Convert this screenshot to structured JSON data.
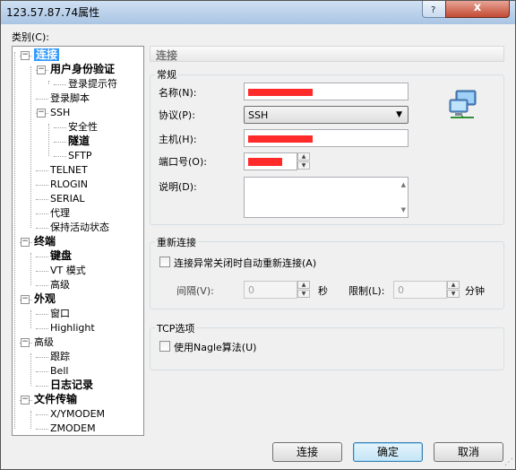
{
  "window": {
    "title": "123.57.87.74属性",
    "close_glyph": "x"
  },
  "category_label": "类别(C):",
  "tree": {
    "items": [
      {
        "label": "连接",
        "level": 0,
        "bold": true,
        "selected": true,
        "expanded": true
      },
      {
        "label": "用户身份验证",
        "level": 1,
        "bold": true,
        "expanded": true
      },
      {
        "label": "登录提示符",
        "level": 2
      },
      {
        "label": "登录脚本",
        "level": 1
      },
      {
        "label": "SSH",
        "level": 1,
        "expanded": true
      },
      {
        "label": "安全性",
        "level": 2
      },
      {
        "label": "隧道",
        "level": 2,
        "bold": true
      },
      {
        "label": "SFTP",
        "level": 2
      },
      {
        "label": "TELNET",
        "level": 1
      },
      {
        "label": "RLOGIN",
        "level": 1
      },
      {
        "label": "SERIAL",
        "level": 1
      },
      {
        "label": "代理",
        "level": 1
      },
      {
        "label": "保持活动状态",
        "level": 1
      },
      {
        "label": "终端",
        "level": 0,
        "bold": true,
        "expanded": true
      },
      {
        "label": "键盘",
        "level": 1,
        "bold": true
      },
      {
        "label": "VT 模式",
        "level": 1
      },
      {
        "label": "高级",
        "level": 1
      },
      {
        "label": "外观",
        "level": 0,
        "bold": true,
        "expanded": true
      },
      {
        "label": "窗口",
        "level": 1
      },
      {
        "label": "Highlight",
        "level": 1
      },
      {
        "label": "高级",
        "level": 0,
        "expanded": true
      },
      {
        "label": "跟踪",
        "level": 1
      },
      {
        "label": "Bell",
        "level": 1
      },
      {
        "label": "日志记录",
        "level": 1,
        "bold": true
      },
      {
        "label": "文件传输",
        "level": 0,
        "bold": true,
        "expanded": true
      },
      {
        "label": "X/YMODEM",
        "level": 1
      },
      {
        "label": "ZMODEM",
        "level": 1
      }
    ]
  },
  "panel": {
    "header": "连接",
    "general": {
      "title": "常规",
      "name_label": "名称(N):",
      "protocol_label": "协议(P):",
      "protocol_value": "SSH",
      "host_label": "主机(H):",
      "port_label": "端口号(O):",
      "desc_label": "说明(D):"
    },
    "reconnect": {
      "title": "重新连接",
      "auto_reconnect_label": "连接异常关闭时自动重新连接(A)",
      "interval_label": "间隔(V):",
      "interval_value": "0",
      "interval_unit": "秒",
      "limit_label": "限制(L):",
      "limit_value": "0",
      "limit_unit": "分钟"
    },
    "tcp": {
      "title": "TCP选项",
      "nagle_label": "使用Nagle算法(U)"
    }
  },
  "buttons": {
    "connect": "连接",
    "ok": "确定",
    "cancel": "取消"
  },
  "colors": {
    "selection": "#3399ff",
    "redaction": "#ff2b2b",
    "close_button": "#c24b33"
  }
}
